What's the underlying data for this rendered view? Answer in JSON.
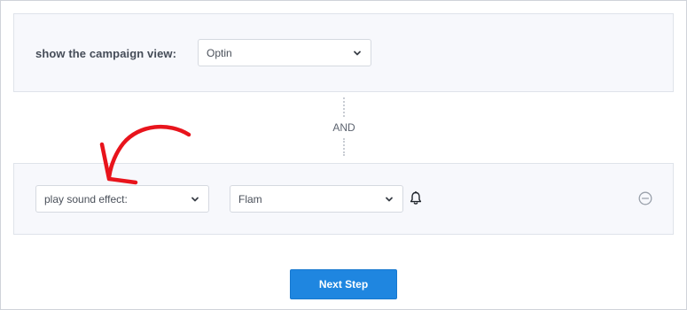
{
  "condition_block": {
    "label": "show the campaign view:",
    "select_value": "Optin"
  },
  "connector": {
    "text": "AND"
  },
  "action_block": {
    "action_select_value": "play sound effect:",
    "sound_select_value": "Flam"
  },
  "footer": {
    "next_button_label": "Next Step"
  },
  "colors": {
    "primary_button": "#1f86e0",
    "panel_background": "#f7f8fc",
    "annotation_arrow": "#e8141c"
  },
  "icons": {
    "select_caret": "chevron-down-icon",
    "sound": "bell-icon",
    "remove": "minus-circle-icon"
  }
}
